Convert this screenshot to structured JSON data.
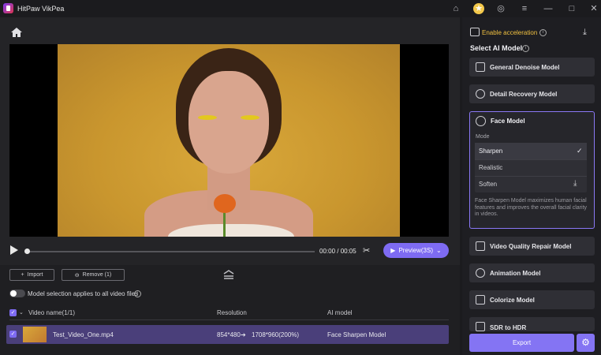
{
  "app": {
    "title": "HitPaw VikPea"
  },
  "player": {
    "time": "00:00 / 00:05",
    "preview_label": "Preview(3S)"
  },
  "toolbar": {
    "import_label": "Import",
    "remove_label": "Remove (1)"
  },
  "model_toggle": {
    "label": "Model selection applies to all video files",
    "enabled": false
  },
  "table": {
    "headers": {
      "name": "Video name(1/1)",
      "resolution": "Resolution",
      "ai_model": "AI model"
    },
    "rows": [
      {
        "name": "Test_Video_One.mp4",
        "resolution_from": "854*480",
        "resolution_to": "1708*960(200%)",
        "ai_model": "Face Sharpen Model"
      }
    ]
  },
  "sidebar": {
    "accel_label": "Enable acceleration",
    "select_label": "Select AI Model",
    "models": [
      "General Denoise Model",
      "Detail Recovery Model",
      "Face Model",
      "Video Quality Repair Model",
      "Animation Model",
      "Colorize Model",
      "SDR to HDR"
    ],
    "mode_label": "Mode",
    "modes": [
      "Sharpen",
      "Realistic",
      "Soften"
    ],
    "selected_mode": "Sharpen",
    "face_description": "Face Sharpen Model maximizes human facial features and improves the overall facial clarity in videos.",
    "export_label": "Export"
  },
  "colors": {
    "accent": "#7e6bf2",
    "selected_row": "#4a3f7a"
  }
}
